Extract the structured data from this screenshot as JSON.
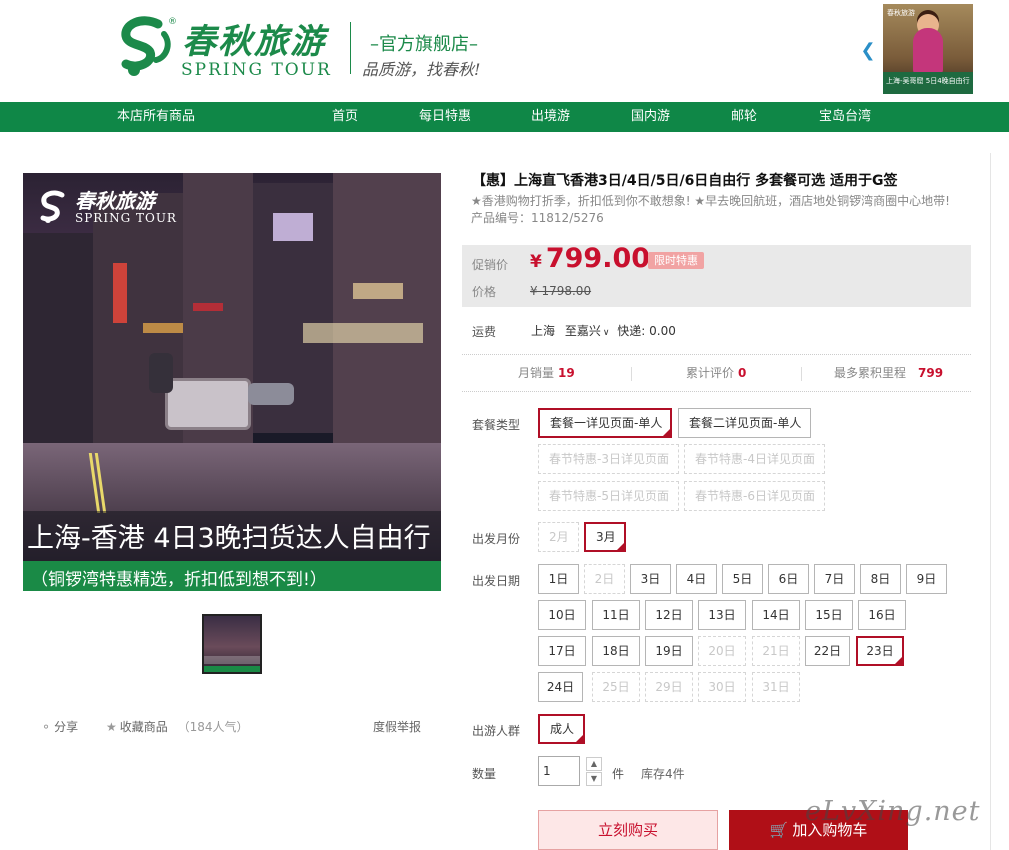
{
  "header": {
    "brand_cn": "春秋旅游",
    "brand_en": "SPRING TOUR",
    "registered": "®",
    "store_title": "–官方旗舰店–",
    "slogan": "品质游，找春秋!",
    "carousel_prev_icon": "chevron-left-icon",
    "ad_thumb": {
      "logo": "春秋旅游",
      "text": "上海-吴哥窟 5日4晚自由行"
    }
  },
  "nav": {
    "items": [
      "本店所有商品",
      "首页",
      "每日特惠",
      "出境游",
      "国内游",
      "邮轮",
      "宝岛台湾"
    ]
  },
  "gallery": {
    "logo_cn": "春秋旅游",
    "logo_en": "SPRING TOUR",
    "caption": "上海-香港  4日3晚扫货达人自由行",
    "subcaption": "（铜锣湾特惠精选，折扣低到想不到!）",
    "share": "分享",
    "favorite": "收藏商品",
    "popularity": "（184人气）",
    "report": "度假举报"
  },
  "product": {
    "title": "【惠】上海直飞香港3日/4日/5日/6日自由行 多套餐可选 适用于G签",
    "subtitle": "★香港购物打折季，折扣低到你不敢想象!  ★早去晚回航班，酒店地处铜锣湾商圈中心地带!",
    "code_label": "产品编号：",
    "code": "11812/5276",
    "price": {
      "promo_label": "促销价",
      "currency": "¥",
      "promo_price": "799.00",
      "badge": "限时特惠",
      "orig_label": "价格",
      "orig_price": "¥ 1798.00"
    },
    "shipping": {
      "label": "运费",
      "from": "上海",
      "to": "至嘉兴",
      "method": "快递: 0.00"
    },
    "stats": {
      "monthly_sales_label": "月销量",
      "monthly_sales": "19",
      "reviews_label": "累计评价",
      "reviews": "0",
      "points_label": "最多累积里程",
      "points": "799"
    }
  },
  "options": {
    "package_label": "套餐类型",
    "packages": [
      {
        "label": "套餐一详见页面-单人",
        "state": "selected"
      },
      {
        "label": "套餐二详见页面-单人",
        "state": "normal"
      },
      {
        "label": "春节特惠-3日详见页面",
        "state": "disabled"
      },
      {
        "label": "春节特惠-4日详见页面",
        "state": "disabled"
      },
      {
        "label": "春节特惠-5日详见页面",
        "state": "disabled"
      },
      {
        "label": "春节特惠-6日详见页面",
        "state": "disabled"
      }
    ],
    "month_label": "出发月份",
    "months": [
      {
        "label": "2月",
        "state": "disabled"
      },
      {
        "label": "3月",
        "state": "selected"
      }
    ],
    "date_label": "出发日期",
    "dates": [
      {
        "label": "1日",
        "state": "normal"
      },
      {
        "label": "2日",
        "state": "disabled"
      },
      {
        "label": "3日",
        "state": "normal"
      },
      {
        "label": "4日",
        "state": "normal"
      },
      {
        "label": "5日",
        "state": "normal"
      },
      {
        "label": "6日",
        "state": "normal"
      },
      {
        "label": "7日",
        "state": "normal"
      },
      {
        "label": "8日",
        "state": "normal"
      },
      {
        "label": "9日",
        "state": "normal"
      },
      {
        "label": "10日",
        "state": "normal"
      },
      {
        "label": "11日",
        "state": "normal"
      },
      {
        "label": "12日",
        "state": "normal"
      },
      {
        "label": "13日",
        "state": "normal"
      },
      {
        "label": "14日",
        "state": "normal"
      },
      {
        "label": "15日",
        "state": "normal"
      },
      {
        "label": "16日",
        "state": "normal"
      },
      {
        "label": "17日",
        "state": "normal"
      },
      {
        "label": "18日",
        "state": "normal"
      },
      {
        "label": "19日",
        "state": "normal"
      },
      {
        "label": "20日",
        "state": "disabled"
      },
      {
        "label": "21日",
        "state": "disabled"
      },
      {
        "label": "22日",
        "state": "normal"
      },
      {
        "label": "23日",
        "state": "selected"
      },
      {
        "label": "24日",
        "state": "normal"
      },
      {
        "label": "25日",
        "state": "disabled"
      },
      {
        "label": "29日",
        "state": "disabled"
      },
      {
        "label": "30日",
        "state": "disabled"
      },
      {
        "label": "31日",
        "state": "disabled"
      }
    ],
    "crowd_label": "出游人群",
    "crowd": [
      {
        "label": "成人",
        "state": "selected"
      }
    ],
    "qty_label": "数量",
    "qty_value": "1",
    "qty_unit": "件",
    "stock": "库存4件"
  },
  "actions": {
    "buy_now": "立刻购买",
    "add_to_cart": "加入购物车",
    "cart_icon": "cart-icon"
  },
  "watermark": "eLvXing.net",
  "colors": {
    "brand_green": "#0f8747",
    "price_red": "#c8102e",
    "selected_border": "#b00f26",
    "cart_button": "#b00f17",
    "badge_pink": "#f1a3a3"
  }
}
